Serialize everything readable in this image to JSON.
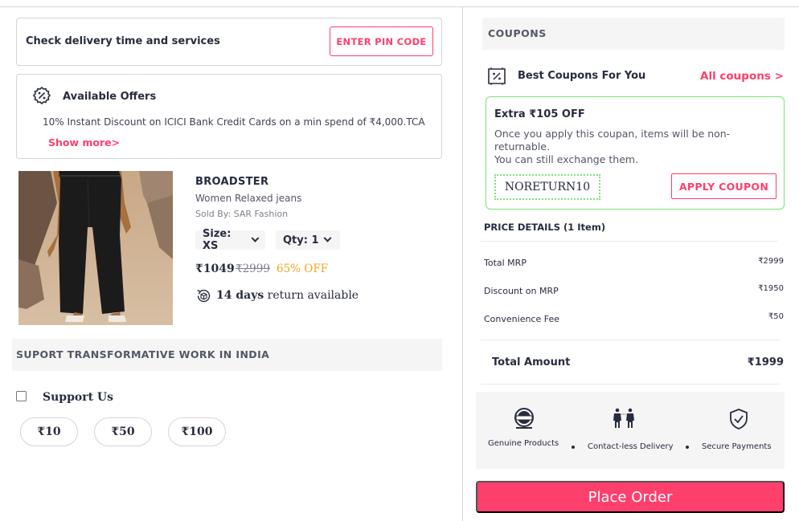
{
  "delivery": {
    "text": "Check delivery time and services",
    "button": "ENTER PIN CODE"
  },
  "offers": {
    "title": "Available Offers",
    "line": "10% Instant Discount on ICICI Bank Credit Cards on a min spend of ₹4,000.TCA",
    "show_more": "Show more>"
  },
  "product": {
    "brand": "BROADSTER",
    "name": "Women Relaxed jeans",
    "seller": "Sold By: SAR Fashion",
    "size": "Size: XS",
    "qty": "Qty: 1",
    "price": "₹1049",
    "mrp": "₹2999",
    "discount": "65% OFF",
    "return_days": "14 days",
    "return_text": " return available"
  },
  "support": {
    "title": "SUPORT TRANSFORMATIVE WORK IN INDIA",
    "label": "Support Us",
    "amounts": [
      "₹10",
      "₹50",
      "₹100"
    ]
  },
  "coupons": {
    "section_title": "COUPONS",
    "best": "Best Coupons For You",
    "all": "All coupons >",
    "offer_title": "Extra ₹105 OFF",
    "desc1": "Once you apply this coupan, items will be non-returnable.",
    "desc2": "You can still exchange them.",
    "code": "NORETURN10",
    "apply": "APPLY COUPON"
  },
  "price_details": {
    "title": "PRICE DETAILS (1 Item)",
    "rows": [
      {
        "label": "Total MRP",
        "value": "₹2999"
      },
      {
        "label": "Discount on MRP",
        "value": "₹1950"
      },
      {
        "label": "Convenience Fee",
        "value": "₹50"
      }
    ],
    "total_label": "Total Amount",
    "total_value": "₹1999"
  },
  "trust": {
    "genuine": "Genuine Products",
    "contactless": "Contact-less Delivery",
    "secure": "Secure Payments"
  },
  "place_order": "Place Order",
  "colors": {
    "accent": "#ff3f6c",
    "offer": "#f5a623",
    "coupon_border": "#7ce27c"
  }
}
